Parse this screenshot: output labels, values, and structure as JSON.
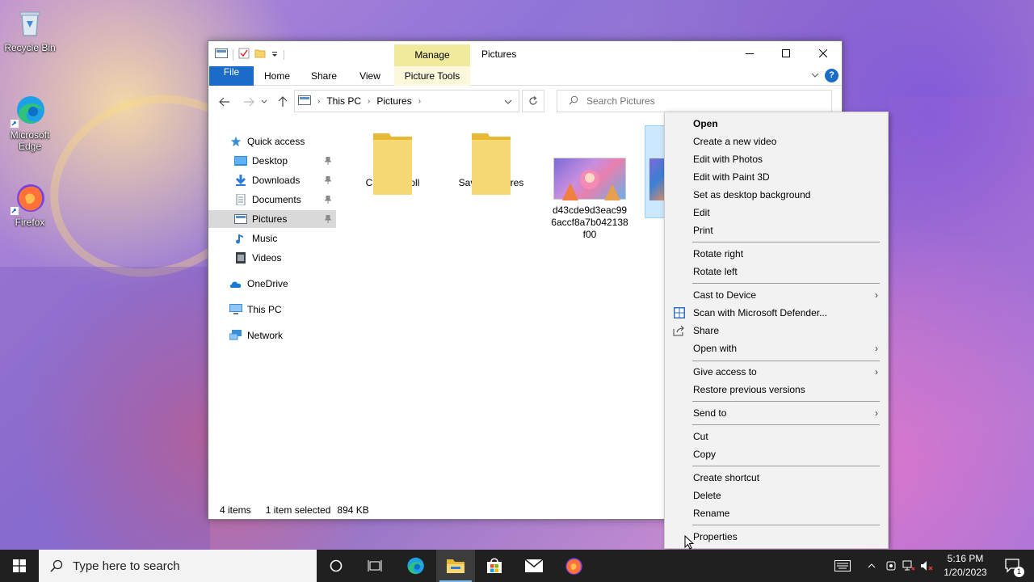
{
  "desktop": {
    "icons": [
      {
        "label": "Recycle Bin"
      },
      {
        "label": "Microsoft Edge"
      },
      {
        "label": "Firefox"
      }
    ]
  },
  "window": {
    "title": "Pictures",
    "contextual_tab": "Manage",
    "ribbon_tabs": {
      "file": "File",
      "home": "Home",
      "share": "Share",
      "view": "View",
      "picture_tools": "Picture Tools"
    },
    "help": "?",
    "address": {
      "crumbs": [
        "This PC",
        "Pictures"
      ]
    },
    "search": {
      "placeholder": "Search Pictures"
    },
    "nav": {
      "quick_access": "Quick access",
      "desktop": "Desktop",
      "downloads": "Downloads",
      "documents": "Documents",
      "pictures": "Pictures",
      "music": "Music",
      "videos": "Videos",
      "onedrive": "OneDrive",
      "this_pc": "This PC",
      "network": "Network"
    },
    "files": [
      {
        "name": "Camera Roll",
        "type": "folder"
      },
      {
        "name": "Saved Pictures",
        "type": "folder"
      },
      {
        "name": "d43cde9d3eac996accf8a7b042138f00",
        "type": "image",
        "line1": "d43cde9d3eac99",
        "line2": "6accf8a7b042138",
        "line3": "f00"
      },
      {
        "name": "",
        "type": "image-selected"
      }
    ],
    "status": {
      "items": "4 items",
      "selected": "1 item selected",
      "size": "894 KB"
    }
  },
  "context_menu": {
    "open": "Open",
    "create_video": "Create a new video",
    "edit_photos": "Edit with Photos",
    "edit_paint3d": "Edit with Paint 3D",
    "set_background": "Set as desktop background",
    "edit": "Edit",
    "print": "Print",
    "rotate_right": "Rotate right",
    "rotate_left": "Rotate left",
    "cast": "Cast to Device",
    "scan": "Scan with Microsoft Defender...",
    "share": "Share",
    "open_with": "Open with",
    "give_access": "Give access to",
    "restore": "Restore previous versions",
    "send_to": "Send to",
    "cut": "Cut",
    "copy": "Copy",
    "create_shortcut": "Create shortcut",
    "delete": "Delete",
    "rename": "Rename",
    "properties": "Properties"
  },
  "taskbar": {
    "search_placeholder": "Type here to search",
    "time": "5:16 PM",
    "date": "1/20/2023",
    "notification_count": "1"
  },
  "colors": {
    "accent": "#1a6cc8",
    "manage_tab": "#f0ea9c",
    "selection": "#cce8ff",
    "taskbar": "#202020"
  }
}
